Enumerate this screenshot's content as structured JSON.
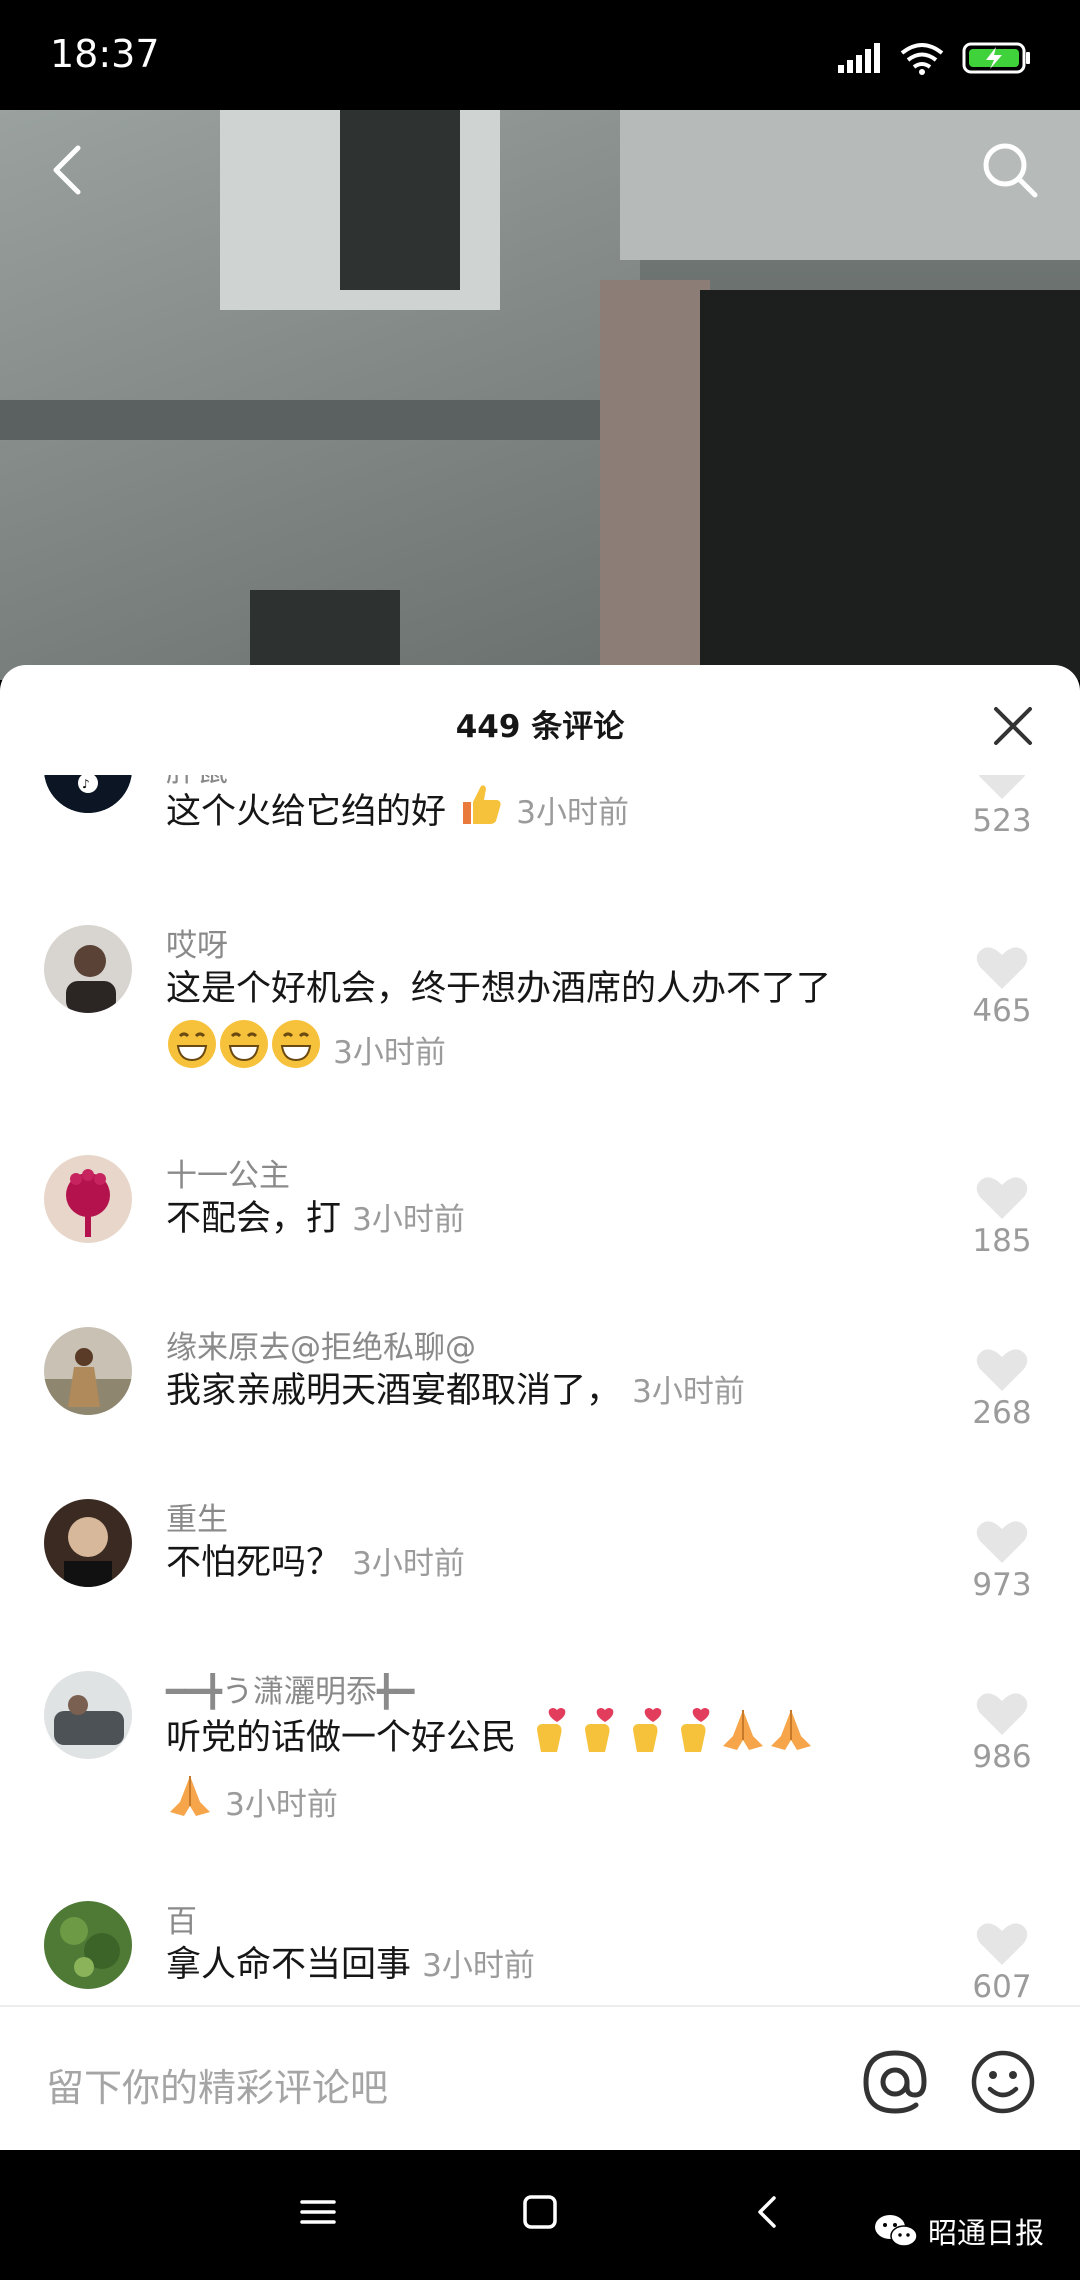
{
  "status": {
    "time": "18:37"
  },
  "header": {
    "title": "449 条评论"
  },
  "comments": [
    {
      "name": "胖鼠",
      "text": "这个火给它绉的好",
      "time": "3小时前",
      "likes": "523"
    },
    {
      "name": "哎呀",
      "text": "这是个好机会，终于想办酒席的人办不了了",
      "time": "3小时前",
      "likes": "465"
    },
    {
      "name": "十一公主",
      "text": "不配会，打",
      "time": "3小时前",
      "likes": "185"
    },
    {
      "name": "缘来原去@拒绝私聊@",
      "text": "我家亲戚明天酒宴都取消了，",
      "time": "3小时前",
      "likes": "268"
    },
    {
      "name": "重生",
      "text": "不怕死吗？",
      "time": "3小时前",
      "likes": "973"
    },
    {
      "name": "━━╋う潇灑明忝╋━",
      "text": "听党的话做一个好公民",
      "time": "3小时前",
      "likes": "986"
    },
    {
      "name": "百",
      "text": "拿人命不当回事",
      "time": "3小时前",
      "likes": "607"
    }
  ],
  "input": {
    "placeholder": "留下你的精彩评论吧"
  },
  "watermark": {
    "text": "昭通日报"
  },
  "colors": {
    "heart": "#e5e5e5",
    "muted": "#9b9b9b",
    "text": "#161616",
    "emoji": "#f7c23b"
  },
  "icons": [
    "back-icon",
    "search-icon",
    "close-icon",
    "heart-icon",
    "at-icon",
    "smiley-icon",
    "menu-icon",
    "home-icon",
    "nav-back-icon",
    "wechat-icon"
  ]
}
